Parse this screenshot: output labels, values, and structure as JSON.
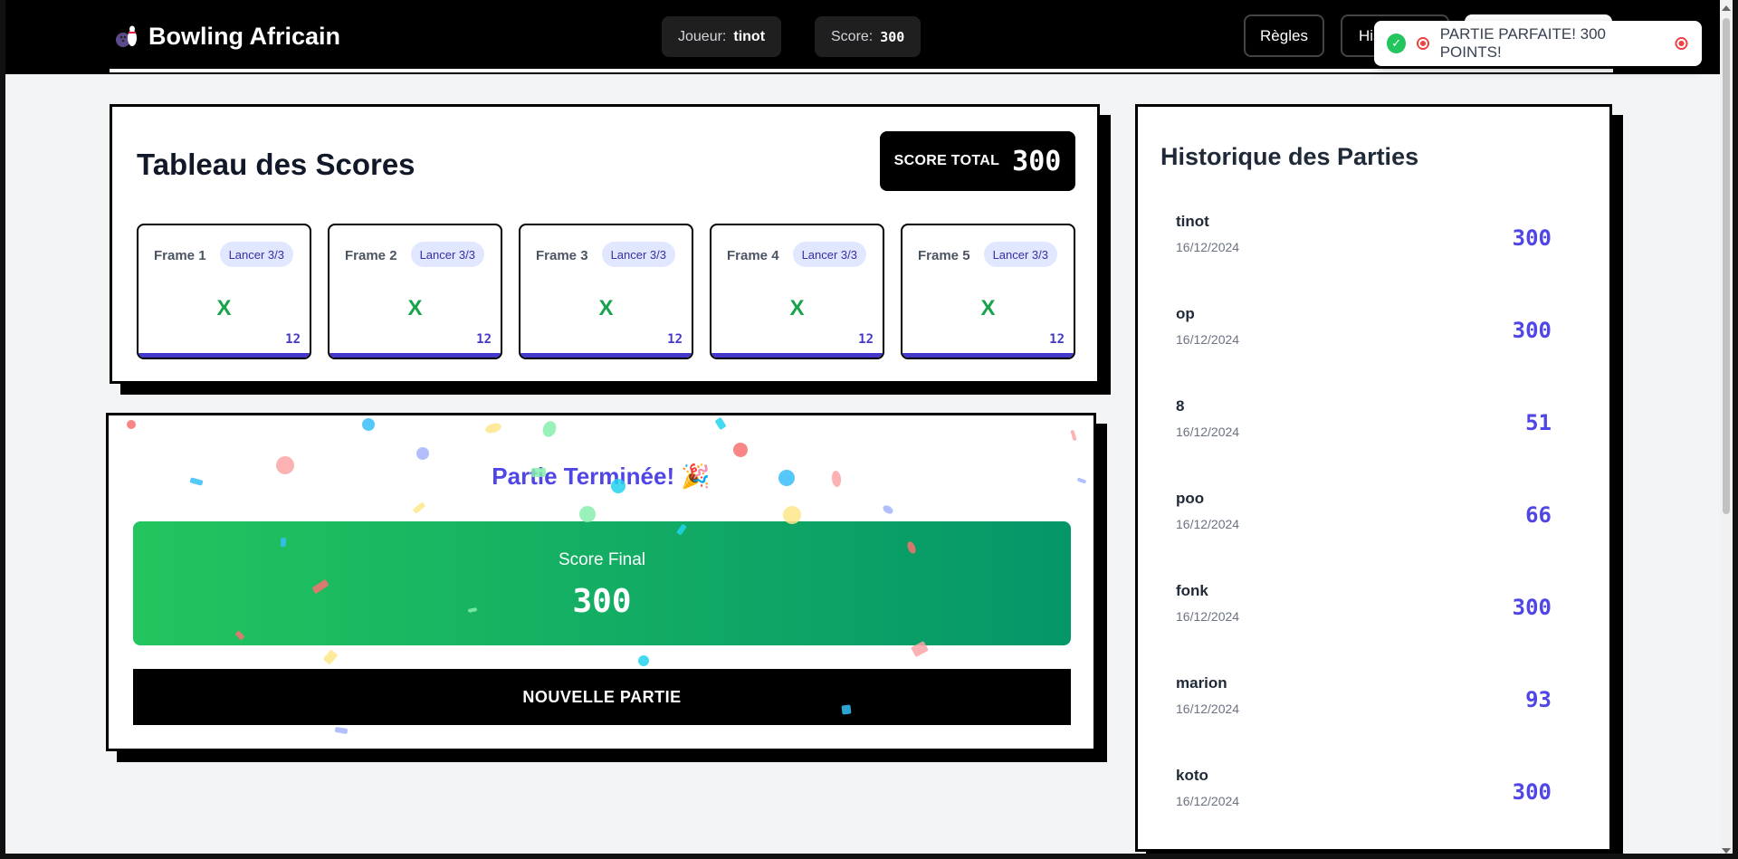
{
  "header": {
    "brand": "Bowling Africain",
    "player_label": "Joueur:",
    "player_name": "tinot",
    "score_label": "Score:",
    "score_value": "300",
    "rules_button": "Règles",
    "history_button": "Historique"
  },
  "toast": {
    "message": "PARTIE PARFAITE! 300 POINTS!"
  },
  "scoreboard": {
    "title": "Tableau des Scores",
    "total_label": "SCORE TOTAL",
    "total_value": "300",
    "frames": [
      {
        "name": "Frame 1",
        "badge": "Lancer 3/3",
        "mark": "X",
        "score": "12"
      },
      {
        "name": "Frame 2",
        "badge": "Lancer 3/3",
        "mark": "X",
        "score": "12"
      },
      {
        "name": "Frame 3",
        "badge": "Lancer 3/3",
        "mark": "X",
        "score": "12"
      },
      {
        "name": "Frame 4",
        "badge": "Lancer 3/3",
        "mark": "X",
        "score": "12"
      },
      {
        "name": "Frame 5",
        "badge": "Lancer 3/3",
        "mark": "X",
        "score": "12"
      }
    ]
  },
  "game_over": {
    "title": "Partie Terminée! 🎉",
    "final_label": "Score Final",
    "final_value": "300",
    "new_game_button": "NOUVELLE PARTIE"
  },
  "history": {
    "title": "Historique des Parties",
    "items": [
      {
        "name": "tinot",
        "date": "16/12/2024",
        "score": "300"
      },
      {
        "name": "op",
        "date": "16/12/2024",
        "score": "300"
      },
      {
        "name": "8",
        "date": "16/12/2024",
        "score": "51"
      },
      {
        "name": "poo",
        "date": "16/12/2024",
        "score": "66"
      },
      {
        "name": "fonk",
        "date": "16/12/2024",
        "score": "300"
      },
      {
        "name": "marion",
        "date": "16/12/2024",
        "score": "93"
      },
      {
        "name": "koto",
        "date": "16/12/2024",
        "score": "300"
      }
    ]
  },
  "colors": {
    "accent": "#4f46e5",
    "success": "#22c55e",
    "strike": "#16a34a"
  }
}
